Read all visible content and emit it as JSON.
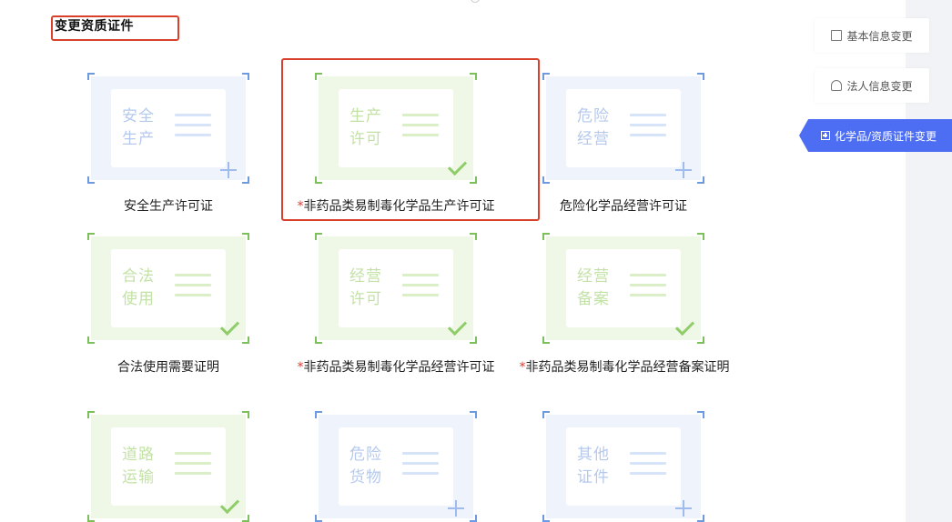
{
  "section": {
    "title": "变更资质证件"
  },
  "tiles": [
    {
      "card_line1": "安全",
      "card_line2": "生产",
      "caption": "安全生产许可证",
      "required": false,
      "state": "add"
    },
    {
      "card_line1": "生产",
      "card_line2": "许可",
      "caption": "非药品类易制毒化学品生产许可证",
      "required": true,
      "state": "done"
    },
    {
      "card_line1": "危险",
      "card_line2": "经营",
      "caption": "危险化学品经营许可证",
      "required": false,
      "state": "add"
    },
    {
      "card_line1": "合法",
      "card_line2": "使用",
      "caption": "合法使用需要证明",
      "required": false,
      "state": "done"
    },
    {
      "card_line1": "经营",
      "card_line2": "许可",
      "caption": "非药品类易制毒化学品经营许可证",
      "required": true,
      "state": "done"
    },
    {
      "card_line1": "经营",
      "card_line2": "备案",
      "caption": "非药品类易制毒化学品经营备案证明",
      "required": true,
      "state": "done"
    },
    {
      "card_line1": "道路",
      "card_line2": "运输",
      "caption": "",
      "required": false,
      "state": "done"
    },
    {
      "card_line1": "危险",
      "card_line2": "货物",
      "caption": "",
      "required": false,
      "state": "add"
    },
    {
      "card_line1": "其他",
      "card_line2": "证件",
      "caption": "",
      "required": false,
      "state": "add"
    }
  ],
  "required_mark": "*",
  "side_nav": {
    "basic_info": "基本信息变更",
    "legal_person": "法人信息变更",
    "chemical_cert": "化学品/资质证件变更"
  },
  "colors": {
    "highlight": "#d9402b",
    "accent": "#4d6ef2",
    "required": "#e23a2e"
  }
}
